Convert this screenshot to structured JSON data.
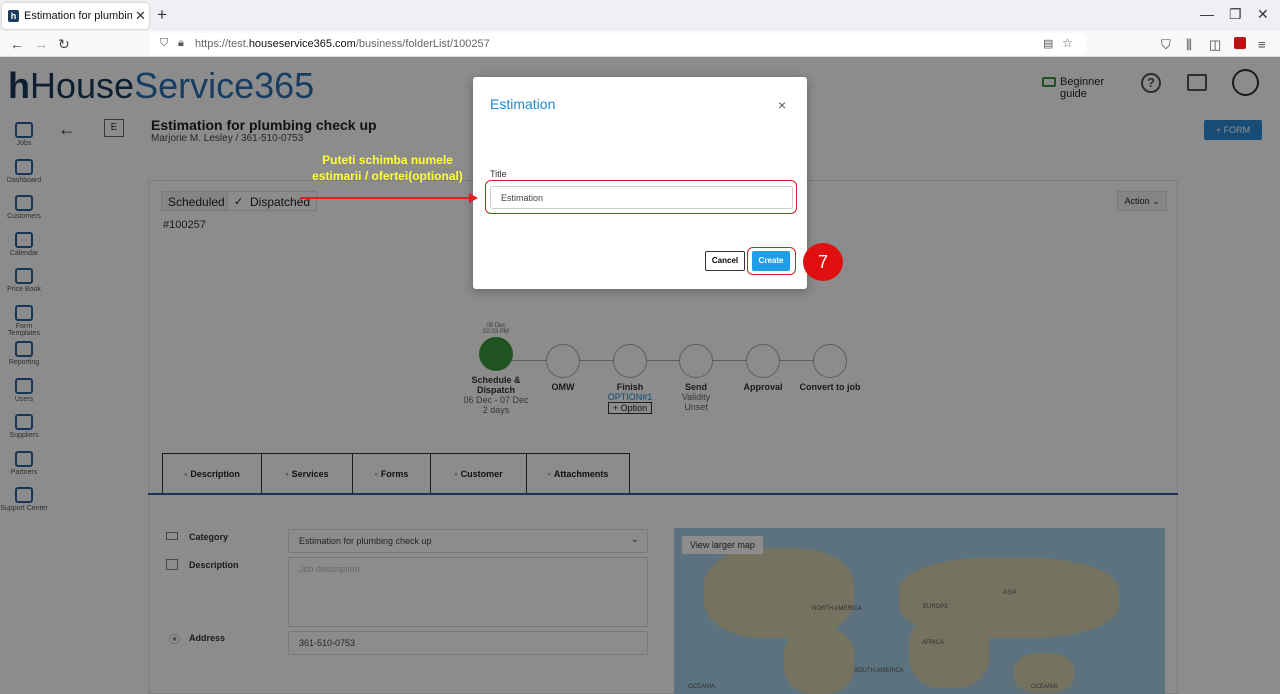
{
  "browser": {
    "tab_title": "Estimation for plumbing check up",
    "url_prefix": "https://test.",
    "url_domain": "houseservice365.com",
    "url_path": "/business/folderList/100257"
  },
  "app": {
    "logo_prefix": "House",
    "logo_suffix": "Service365",
    "beginner_guide": "Beginner guide",
    "help_glyph": "?"
  },
  "sidebar": {
    "items": [
      {
        "label": "Jobs",
        "icon": "tools-icon"
      },
      {
        "label": "Dashboard",
        "icon": "chart-icon"
      },
      {
        "label": "Customers",
        "icon": "customers-icon"
      },
      {
        "label": "Calendar",
        "icon": "calendar-icon"
      },
      {
        "label": "Price Book",
        "icon": "price-book-icon"
      },
      {
        "label": "Form Templates",
        "icon": "form-icon"
      },
      {
        "label": "Reporting",
        "icon": "report-icon"
      },
      {
        "label": "Users",
        "icon": "users-icon"
      },
      {
        "label": "Suppliers",
        "icon": "truck-icon"
      },
      {
        "label": "Partners",
        "icon": "partners-icon"
      },
      {
        "label": "Support Center",
        "icon": "support-icon"
      }
    ]
  },
  "page": {
    "title": "Estimation for plumbing check up",
    "subtitle": "Marjorie M. Lesley / 361-510-0753",
    "e_badge": "E",
    "form_button": "+ FORM"
  },
  "job": {
    "status_scheduled": "Scheduled",
    "status_dispatched": "Dispatched",
    "number": "#100257",
    "action": "Action"
  },
  "steps": [
    {
      "date": "05 Dec",
      "time": "02:03 PM",
      "name": "Schedule & Dispatch",
      "sub": "06 Dec - 07 Dec",
      "sub2": "2 days"
    },
    {
      "name": "OMW"
    },
    {
      "name": "Finish",
      "sub": "OPTION#1",
      "sub2": "+ Option"
    },
    {
      "name": "Send",
      "sub": "Validity",
      "sub2": "Unset"
    },
    {
      "name": "Approval"
    },
    {
      "name": "Convert to job"
    }
  ],
  "tabs": [
    "Description",
    "Services",
    "Forms",
    "Customer",
    "Attachments"
  ],
  "form": {
    "category_label": "Category",
    "category_value": "Estimation for plumbing check up",
    "description_label": "Description",
    "description_placeholder": "Job description",
    "address_label": "Address",
    "address_value": "361-510-0753",
    "map_button": "View larger map",
    "map_labels": [
      "NORTH AMERICA",
      "EUROPE",
      "ASIA",
      "AFRICA",
      "SOUTH AMERICA",
      "OCEANIA",
      "OCEANIA"
    ]
  },
  "modal": {
    "title": "Estimation",
    "close": "×",
    "title_label": "Title",
    "title_value": "Estimation",
    "cancel": "Cancel",
    "create": "Create"
  },
  "annotation": {
    "text_line1": "Puteti schimba numele",
    "text_line2": "estimarii / ofertei(optional)",
    "step_number": "7"
  },
  "colors": {
    "accent": "#1f8ad0",
    "create_button": "#1f9ee8",
    "highlight": "#d02020",
    "annotation_text": "#ffff33"
  }
}
